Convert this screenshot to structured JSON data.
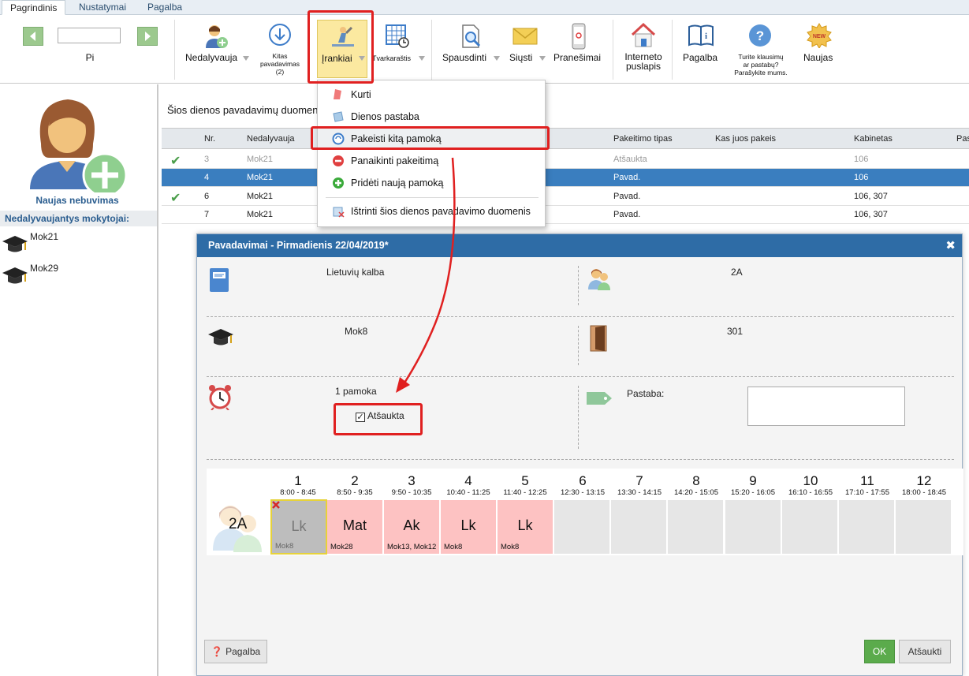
{
  "tabs": [
    "Pagrindinis",
    "Nustatymai",
    "Pagalba"
  ],
  "ribbon": {
    "day_label": "Pi",
    "nedalyvauja": "Nedalyvauja",
    "kitas_line1": "Kitas",
    "kitas_line2": "pavadavimas",
    "kitas_line3": "(2)",
    "irankiai": "Įrankiai",
    "tvarkarastis": "Tvarkaraštis",
    "spausdinti": "Spausdinti",
    "siusti": "Siųsti",
    "pranesimai": "Pranešimai",
    "internetas_line1": "Interneto",
    "internetas_line2": "puslapis",
    "pagalba": "Pagalba",
    "klausimai_line1": "Turite klausimų",
    "klausimai_line2": "ar pastabų?",
    "klausimai_line3": "Parašykite mums.",
    "naujas": "Naujas",
    "new_badge": "NEW"
  },
  "sidebar": {
    "title": "Naujas nebuvimas",
    "header": "Nedalyvaujantys mokytojai:",
    "teachers": [
      "Mok21",
      "Mok29"
    ]
  },
  "main": {
    "title": "Šios dienos pavadavimų duomeny",
    "columns": {
      "nr": "Nr.",
      "nedalyvauja": "Nedalyvauja",
      "pakeitimo_tipas": "Pakeitimo tipas",
      "kas_pakeis": "Kas juos pakeis",
      "kabinetas": "Kabinetas",
      "extra": "Pas"
    },
    "rows": [
      {
        "nr": "3",
        "teacher": "Mok21",
        "type": "Atšaukta",
        "room": "106"
      },
      {
        "nr": "4",
        "teacher": "Mok21",
        "type": "Pavad.",
        "room": "106"
      },
      {
        "nr": "6",
        "teacher": "Mok21",
        "type": "Pavad.",
        "room": "106, 307"
      },
      {
        "nr": "7",
        "teacher": "Mok21",
        "type": "Pavad.",
        "room": "106, 307"
      }
    ]
  },
  "menu": {
    "items": [
      "Kurti",
      "Dienos pastaba",
      "Pakeisti kitą pamoką",
      "Panaikinti pakeitimą",
      "Pridėti naują pamoką",
      "Ištrinti šios dienos pavadavimo duomenis"
    ]
  },
  "dialog": {
    "title": "Pavadavimai - Pirmadienis 22/04/2019*",
    "close": "✖",
    "subject": "Lietuvių kalba",
    "class": "2A",
    "teacher": "Mok8",
    "room": "301",
    "lesson": "1 pamoka",
    "cancelled_label": "Atšaukta",
    "note_label": "Pastaba:",
    "help_button": "Pagalba",
    "ok_button": "OK",
    "cancel_button": "Atšaukti"
  },
  "timetable": {
    "class": "2A",
    "periods": [
      {
        "n": "1",
        "time": "8:00 - 8:45"
      },
      {
        "n": "2",
        "time": "8:50 - 9:35"
      },
      {
        "n": "3",
        "time": "9:50 - 10:35"
      },
      {
        "n": "4",
        "time": "10:40 - 11:25"
      },
      {
        "n": "5",
        "time": "11:40 - 12:25"
      },
      {
        "n": "6",
        "time": "12:30 - 13:15"
      },
      {
        "n": "7",
        "time": "13:30 - 14:15"
      },
      {
        "n": "8",
        "time": "14:20 - 15:05"
      },
      {
        "n": "9",
        "time": "15:20 - 16:05"
      },
      {
        "n": "10",
        "time": "16:10 - 16:55"
      },
      {
        "n": "11",
        "time": "17:10 - 17:55"
      },
      {
        "n": "12",
        "time": "18:00 - 18:45"
      }
    ],
    "lessons": [
      {
        "subject": "Lk",
        "teacher": "Mok8"
      },
      {
        "subject": "Mat",
        "teacher": "Mok28"
      },
      {
        "subject": "Ak",
        "teacher": "Mok13, Mok12"
      },
      {
        "subject": "Lk",
        "teacher": "Mok8"
      },
      {
        "subject": "Lk",
        "teacher": "Mok8"
      }
    ]
  },
  "colors": {
    "accent": "#2e6ca6",
    "selected_row": "#3a7ebf",
    "highlight": "#e02020",
    "lesson_pink": "#fdc2c2"
  }
}
